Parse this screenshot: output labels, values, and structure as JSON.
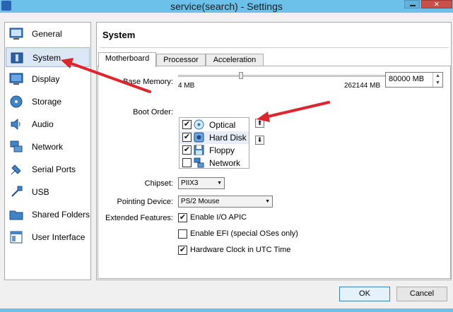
{
  "window": {
    "title": "service(search) - Settings"
  },
  "sidebar": {
    "items": [
      {
        "label": "General",
        "icon": "general-icon"
      },
      {
        "label": "System",
        "icon": "system-icon",
        "selected": true
      },
      {
        "label": "Display",
        "icon": "display-icon"
      },
      {
        "label": "Storage",
        "icon": "storage-icon"
      },
      {
        "label": "Audio",
        "icon": "audio-icon"
      },
      {
        "label": "Network",
        "icon": "network-icon"
      },
      {
        "label": "Serial Ports",
        "icon": "serial-ports-icon"
      },
      {
        "label": "USB",
        "icon": "usb-icon"
      },
      {
        "label": "Shared Folders",
        "icon": "shared-folders-icon"
      },
      {
        "label": "User Interface",
        "icon": "user-interface-icon"
      }
    ]
  },
  "page": {
    "title": "System",
    "tabs": [
      {
        "label": "Motherboard",
        "active": true
      },
      {
        "label": "Processor"
      },
      {
        "label": "Acceleration"
      }
    ]
  },
  "motherboard": {
    "base_memory": {
      "label": "Base Memory:",
      "min_label": "4 MB",
      "max_label": "262144 MB",
      "value": "80000 MB",
      "fraction": 0.305
    },
    "boot_order": {
      "label": "Boot Order:",
      "items": [
        {
          "label": "Optical",
          "checked": true,
          "icon": "optical-disc-icon"
        },
        {
          "label": "Hard Disk",
          "checked": true,
          "icon": "hard-disk-icon",
          "highlighted": true
        },
        {
          "label": "Floppy",
          "checked": true,
          "icon": "floppy-icon"
        },
        {
          "label": "Network",
          "checked": false,
          "icon": "network-boot-icon"
        }
      ]
    },
    "chipset": {
      "label": "Chipset:",
      "value": "PIIX3"
    },
    "pointing_device": {
      "label": "Pointing Device:",
      "value": "PS/2 Mouse"
    },
    "extended_features": {
      "label": "Extended Features:",
      "options": [
        {
          "label": "Enable I/O APIC",
          "checked": true
        },
        {
          "label": "Enable EFI (special OSes only)",
          "checked": false
        },
        {
          "label": "Hardware Clock in UTC Time",
          "checked": true
        }
      ]
    }
  },
  "buttons": {
    "ok": "OK",
    "cancel": "Cancel"
  },
  "colors": {
    "titlebar": "#6cc1ea",
    "annotation_arrow": "#e0242b",
    "selection": "#dbe7f5"
  }
}
